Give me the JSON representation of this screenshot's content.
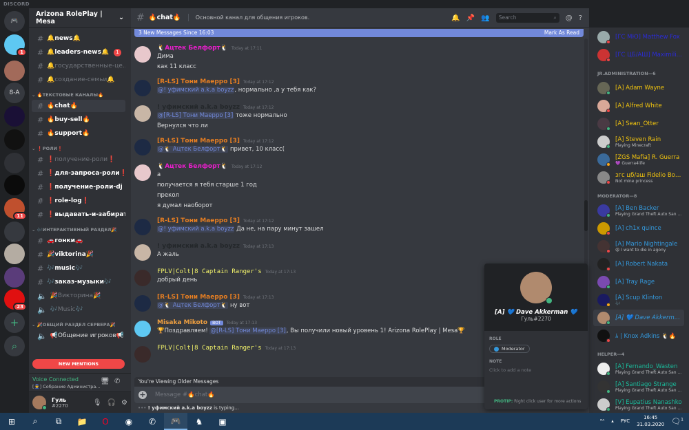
{
  "app_title": "DISCORD",
  "colors": {
    "accent": "#7289da",
    "online": "#43b581",
    "dnd": "#f04747",
    "idle": "#faa61a",
    "mention_red": "#f04747"
  },
  "servers": [
    {
      "label": "",
      "icon": "discord-home-icon",
      "color": "#36393f"
    },
    {
      "label": "",
      "badge": "1",
      "color": "#5ec8f2"
    },
    {
      "label": "",
      "color": "#a26a5a"
    },
    {
      "label": "8-A",
      "color": "#36393f"
    },
    {
      "label": "",
      "color": "#1a1036"
    },
    {
      "label": "",
      "color": "#111"
    },
    {
      "label": "",
      "color": "#2f3136"
    },
    {
      "label": "",
      "color": "#0b0b0b"
    },
    {
      "label": "",
      "badge": "11",
      "color": "#c0502e"
    },
    {
      "label": "",
      "icon": "folder-icon",
      "color": "#36393f"
    },
    {
      "label": "",
      "color": "#b4aca2"
    },
    {
      "label": "",
      "color": "#5a3c7a"
    },
    {
      "label": "",
      "badge": "23",
      "color": "#e01010"
    },
    {
      "label": "+",
      "icon": "add-server-icon",
      "color": "#36393f"
    },
    {
      "label": "⌕",
      "icon": "explore-icon",
      "color": "#36393f"
    }
  ],
  "guild": {
    "name": "Arizona RolePlay | Mesa"
  },
  "channels": [
    {
      "type": "text",
      "name": "🔔news🔔",
      "unread": true
    },
    {
      "type": "text",
      "name": "🔔leaders-news🔔",
      "unread": true,
      "badge": "1"
    },
    {
      "type": "text",
      "name": "🔔государственные-це...",
      "muted": true
    },
    {
      "type": "text",
      "name": "🔔создание-семьи🔔",
      "muted": true
    },
    {
      "type": "category",
      "name": "🔥ТЕКСТОВЫЕ КАНАЛЫ🔥"
    },
    {
      "type": "text",
      "name": "🔥chat🔥",
      "selected": true
    },
    {
      "type": "text",
      "name": "🔥buy-sell🔥",
      "unread": true
    },
    {
      "type": "text",
      "name": "🔥support🔥",
      "unread": true
    },
    {
      "type": "category",
      "name": "❗РОЛИ❗"
    },
    {
      "type": "text",
      "name": "❗получение-роли❗",
      "muted": true
    },
    {
      "type": "text",
      "name": "❗для-запроса-роли❗",
      "unread": true
    },
    {
      "type": "text",
      "name": "❗получение-роли-dj❗",
      "unread": true
    },
    {
      "type": "text",
      "name": "❗role-log❗",
      "unread": true
    },
    {
      "type": "text",
      "name": "❗выдавать-и-забирать-...",
      "unread": true
    },
    {
      "type": "category",
      "name": "🎶ИНТЕРАКТИВНЫЙ РАЗДЕЛ🎉"
    },
    {
      "type": "text",
      "name": "🚗гонки🚗",
      "unread": true
    },
    {
      "type": "text",
      "name": "🎉viktorina🎉",
      "unread": true
    },
    {
      "type": "text",
      "name": "🎶music🎶",
      "unread": true
    },
    {
      "type": "text",
      "name": "🎶заказ-музыки🎶",
      "unread": true
    },
    {
      "type": "voice",
      "name": "🎉Викторина🎉",
      "muted": true
    },
    {
      "type": "voice",
      "name": "🎶Music🎶",
      "muted": true
    },
    {
      "type": "category",
      "name": "🎉ОБЩИЙ РАЗДЕЛ СЕРВЕРА🎉"
    },
    {
      "type": "voice",
      "name": "📢Общение игроков📢"
    }
  ],
  "new_mentions": "NEW MENTIONS",
  "voice": {
    "status": "Voice Connected",
    "channel": "[👮] Собрание Администра..."
  },
  "user": {
    "name": "Гуль",
    "tag": "#2270"
  },
  "header": {
    "channel": "🔥chat🔥",
    "topic": "Основной канал для общения игроков.",
    "search_placeholder": "Search"
  },
  "new_messages_bar": {
    "text": "3 New Messages Since 16:03",
    "action": "Mark As Read"
  },
  "messages": [
    {
      "author": "🐧Ацтек Белфорт🐧",
      "color": "#e91ecc",
      "time": "Today at 17:11",
      "avatar": "#e8c8cc",
      "lines": [
        {
          "text": "Дима"
        },
        {
          "text": "как 11 класс"
        }
      ]
    },
    {
      "author": "[R-LS] Тони Маерро [3]",
      "color": "#e67e22",
      "time": "Today at 17:12",
      "avatar": "#1d2a44",
      "lines": [
        {
          "mention": "@! уфимский a.k.a boyzz",
          "text": ", нормально ,а у тебя как?"
        }
      ]
    },
    {
      "author": "! уфимский a.k.a boyzz",
      "color": "#23272a",
      "time": "Today at 17:12",
      "avatar": "#c8b6a6",
      "lines": [
        {
          "mention": "@[R-LS] Тони Маерро [3]",
          "text": " тоже нормально"
        },
        {
          "text": "Вернулся что ли"
        }
      ]
    },
    {
      "author": "[R-LS] Тони Маерро [3]",
      "color": "#e67e22",
      "time": "Today at 17:12",
      "avatar": "#1d2a44",
      "lines": [
        {
          "mention": "@🐧 Ацтек Белфорт🐧",
          "text": " привет, 10 класс("
        }
      ]
    },
    {
      "author": "🐧Ацтек Белфорт🐧",
      "color": "#e91ecc",
      "time": "Today at 17:12",
      "avatar": "#e8c8cc",
      "lines": [
        {
          "text": "а"
        },
        {
          "text": "получается я тебя старше 1 год"
        },
        {
          "text": "прекол"
        },
        {
          "text": "я думал наоборот"
        }
      ]
    },
    {
      "author": "[R-LS] Тони Маерро [3]",
      "color": "#e67e22",
      "time": "Today at 17:12",
      "avatar": "#1d2a44",
      "lines": [
        {
          "mention": "@! уфимский a.k.a boyzz",
          "text": " Да не, на пару минут зашел"
        }
      ]
    },
    {
      "author": "! уфимский a.k.a boyzz",
      "color": "#23272a",
      "time": "Today at 17:13",
      "avatar": "#c8b6a6",
      "lines": [
        {
          "text": "А жаль"
        }
      ]
    },
    {
      "author": "FPLV|Colt|8 Captain Ranger's",
      "color": "#f1f16a",
      "time": "Today at 17:13",
      "avatar": "#3a2a2a",
      "mono": true,
      "lines": [
        {
          "text": "добрый день"
        }
      ]
    },
    {
      "author": "[R-LS] Тони Маерро [3]",
      "color": "#e67e22",
      "time": "Today at 17:13",
      "avatar": "#1d2a44",
      "lines": [
        {
          "mention": "@🐧 Ацтек Белфорт🐧",
          "text": " ну вот"
        }
      ]
    },
    {
      "author": "Misaka Mikoto",
      "bot": "BOT",
      "color": "#f0a040",
      "time": "Today at 17:13",
      "avatar": "#5ec8f2",
      "lines": [
        {
          "pre": "🏆Поздравляем! ",
          "mention": "@[R-LS] Тони Маерро [3]",
          "text": ", Вы получили новый уровень 1! Arizona RolePlay | Mesa🏆"
        }
      ]
    },
    {
      "author": "FPLV|Colt|8 Captain Ranger's",
      "color": "#f1f16a",
      "time": "Today at 17:13",
      "avatar": "#3a2a2a",
      "mono": true,
      "lines": []
    }
  ],
  "older_messages": "You're Viewing Older Messages",
  "input_placeholder": "Message #🔥chat🔥",
  "typing": {
    "user": "! уфимский a.k.a boyzz",
    "suffix": " is typing..."
  },
  "members": [
    {
      "name": "[ГС МЮ] Matthew Fox",
      "color": "#2b2bd9",
      "status": "dnd",
      "avatar": "#9aa"
    },
    {
      "name": "[ГС ЦБ/АШ] Maximili...",
      "color": "#2b2bd9",
      "status": "dnd",
      "avatar": "#c33"
    },
    {
      "section": "JR.ADMINISTRATION—6"
    },
    {
      "name": "[A] Adam Wayne",
      "color": "#f1c40f",
      "status": "online",
      "avatar": "#665"
    },
    {
      "name": "[A] Alfred White",
      "color": "#f1c40f",
      "status": "dnd",
      "avatar": "#d9a898"
    },
    {
      "name": "[A] Sean_Otter",
      "color": "#f1c40f",
      "status": "online",
      "avatar": "#4a3a44"
    },
    {
      "name": "[A] Steven Rain",
      "color": "#f1c40f",
      "status": "online",
      "avatar": "#ccc",
      "activity": "Playing Minecraft"
    },
    {
      "name": "[ZGS Mafia] R. Guerra",
      "color": "#f1c40f",
      "status": "idle",
      "avatar": "#3a6a9a",
      "activity": "💜 Guerra4life"
    },
    {
      "name": "згс цб/аш Fidelio Bon...",
      "color": "#f1c40f",
      "status": "dnd",
      "avatar": "#888",
      "activity": "Not mine princess"
    },
    {
      "section": "MODERATOR—8"
    },
    {
      "name": "[A] Ben Backer",
      "color": "#3498db",
      "status": "online",
      "avatar": "#3a3aa0",
      "activity": "Playing Grand Theft Auto San ..."
    },
    {
      "name": "[A] ch1x quince",
      "color": "#3498db",
      "status": "dnd",
      "avatar": "#c90"
    },
    {
      "name": "[A] Mario Nightingale",
      "color": "#3498db",
      "status": "dnd",
      "avatar": "#433",
      "activity": "😩 I want to die in agony"
    },
    {
      "name": "[A] Robert Nakata",
      "color": "#3498db",
      "status": "dnd",
      "avatar": "#222"
    },
    {
      "name": "[A] Tray Rage",
      "color": "#3498db",
      "status": "online",
      "avatar": "#7a4ab0"
    },
    {
      "name": "[A] Scup Klinton",
      "color": "#3498db",
      "status": "idle",
      "avatar": "#1a1a60",
      "activity": "🎶"
    },
    {
      "name": "[A] 💙 Dave Akkerm...",
      "color": "#3498db",
      "status": "online",
      "avatar": "#b08a6e",
      "selected": true,
      "italic": true
    },
    {
      "name": "ﾑ | Knox Adkins 🐧🔥",
      "color": "#3498db",
      "status": "dnd",
      "avatar": "#111"
    },
    {
      "section": "HELPER—4"
    },
    {
      "name": "[A] Fernando_Wasten",
      "color": "#1abc9c",
      "status": "online",
      "avatar": "#eee",
      "activity": "Playing Grand Theft Auto San ..."
    },
    {
      "name": "[A] Santiago Strange",
      "color": "#1abc9c",
      "status": "online",
      "avatar": "#333",
      "activity": "Playing Grand Theft Auto San ..."
    },
    {
      "name": "[V] Eupatius Nanashko",
      "color": "#1abc9c",
      "status": "online",
      "avatar": "#ccc",
      "activity": "Playing Grand Theft Auto San ..."
    }
  ],
  "profile_popup": {
    "name": "[A] 💙 Dave Akkerman 💙",
    "tag": "Гуль#2270",
    "role_label": "ROLE",
    "role": "Moderator",
    "role_color": "#3498db",
    "note_label": "NOTE",
    "note_placeholder": "Click to add a note",
    "protip_label": "PROTIP:",
    "protip": " Right click user for more actions"
  },
  "taskbar": {
    "apps": [
      "windows-start-icon",
      "search-icon",
      "task-view-icon",
      "file-explorer-icon",
      "opera-icon",
      "chrome-icon",
      "viber-icon",
      "discord-icon",
      "game-icon",
      "game2-icon"
    ],
    "lang": "РУС",
    "time": "16:45",
    "date": "31.03.2020",
    "notifications": "1"
  }
}
